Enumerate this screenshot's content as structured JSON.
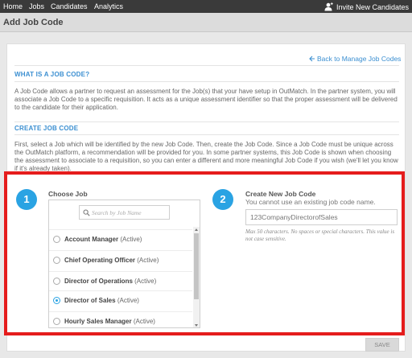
{
  "topnav": {
    "items": [
      "Home",
      "Jobs",
      "Candidates",
      "Analytics"
    ],
    "invite_label": "Invite New Candidates",
    "invite_icon": "user-add-icon"
  },
  "page": {
    "title": "Add Job Code",
    "back_link": "Back to Manage Job Codes"
  },
  "intro": {
    "heading": "WHAT IS A JOB CODE?",
    "text": "A Job Code allows a partner to request an assessment for the Job(s) that your have setup in OutMatch. In the partner system, you will associate a Job Code to a specific requisition. It acts as a unique assessment identifier so that the proper assessment will be delivered to the candidate for their application."
  },
  "create": {
    "heading": "CREATE JOB CODE",
    "text": "First, select a Job which will be identified by the new Job Code. Then, create the Job Code. Since a Job Code must be unique across the OutMatch platform, a recommendation will be provided for you. In some partner systems, this Job Code is shown when choosing the assessment to associate to a requisition, so you can enter a different and more meaningful Job Code if you wish (we'll let you know if it's already taken)."
  },
  "step1": {
    "number": "1",
    "label": "Choose Job",
    "search_placeholder": "Search by Job Name",
    "jobs": [
      {
        "name": "Account Manager",
        "status": "(Active)",
        "selected": false
      },
      {
        "name": "Chief Operating Officer",
        "status": "(Active)",
        "selected": false
      },
      {
        "name": "Director of Operations",
        "status": "(Active)",
        "selected": false
      },
      {
        "name": "Director of Sales",
        "status": "(Active)",
        "selected": true
      },
      {
        "name": "Hourly Sales Manager",
        "status": "(Active)",
        "selected": false
      }
    ]
  },
  "step2": {
    "number": "2",
    "label": "Create New Job Code",
    "hint": "You cannot use an existing job code name.",
    "value": "123CompanyDirectorofSales",
    "note": "Max 50 characters. No spaces or special characters. This value is not case sensitive."
  },
  "save_label": "SAVE",
  "colors": {
    "accent": "#2aa3e3",
    "highlight": "#e51c1c",
    "nav": "#3a3a3a"
  }
}
